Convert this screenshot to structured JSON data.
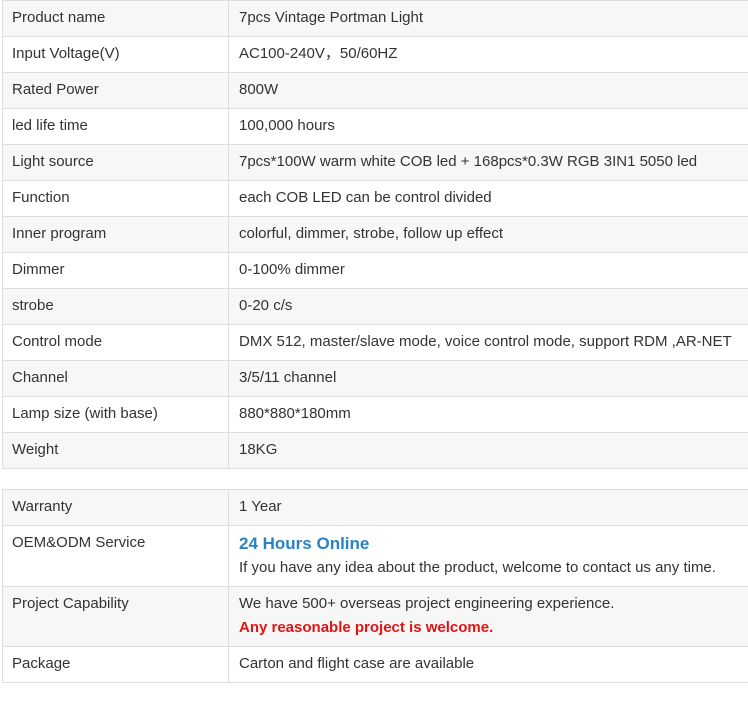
{
  "specs": [
    {
      "label": "Product name",
      "value": "7pcs Vintage Portman Light"
    },
    {
      "label": "Input Voltage(V)",
      "value": "AC100-240V，50/60HZ"
    },
    {
      "label": "Rated Power",
      "value": "800W"
    },
    {
      "label": "led life time",
      "value": "100,000 hours"
    },
    {
      "label": "Light source",
      "value": "7pcs*100W warm white COB led + 168pcs*0.3W RGB 3IN1 5050 led"
    },
    {
      "label": "Function",
      "value": "each COB LED can be control divided"
    },
    {
      "label": "Inner program",
      "value": "colorful, dimmer, strobe, follow up effect"
    },
    {
      "label": "Dimmer",
      "value": "0-100% dimmer"
    },
    {
      "label": "strobe",
      "value": "0-20 c/s"
    },
    {
      "label": "Control mode",
      "value": "DMX 512, master/slave mode, voice control mode, support RDM ,AR-NET"
    },
    {
      "label": "Channel",
      "value": "3/5/11 channel"
    },
    {
      "label": "Lamp size (with base)",
      "value": "880*880*180mm"
    },
    {
      "label": "Weight",
      "value": "18KG"
    }
  ],
  "service": {
    "warranty": {
      "label": "Warranty",
      "value": "1 Year"
    },
    "oem": {
      "label": "OEM&ODM Service",
      "highlight": "24 Hours Online",
      "text": "If you have any idea about the product, welcome to contact us any time."
    },
    "project": {
      "label": "Project Capability",
      "text": "We have 500+ overseas project engineering experience.",
      "highlight": "Any reasonable project is welcome."
    },
    "package": {
      "label": "Package",
      "value": "Carton and flight case are available"
    }
  },
  "colors": {
    "highlight_blue": "#2a82c4",
    "highlight_red": "#e01414",
    "row_alt": "#f7f7f7",
    "border": "#dddddd"
  }
}
